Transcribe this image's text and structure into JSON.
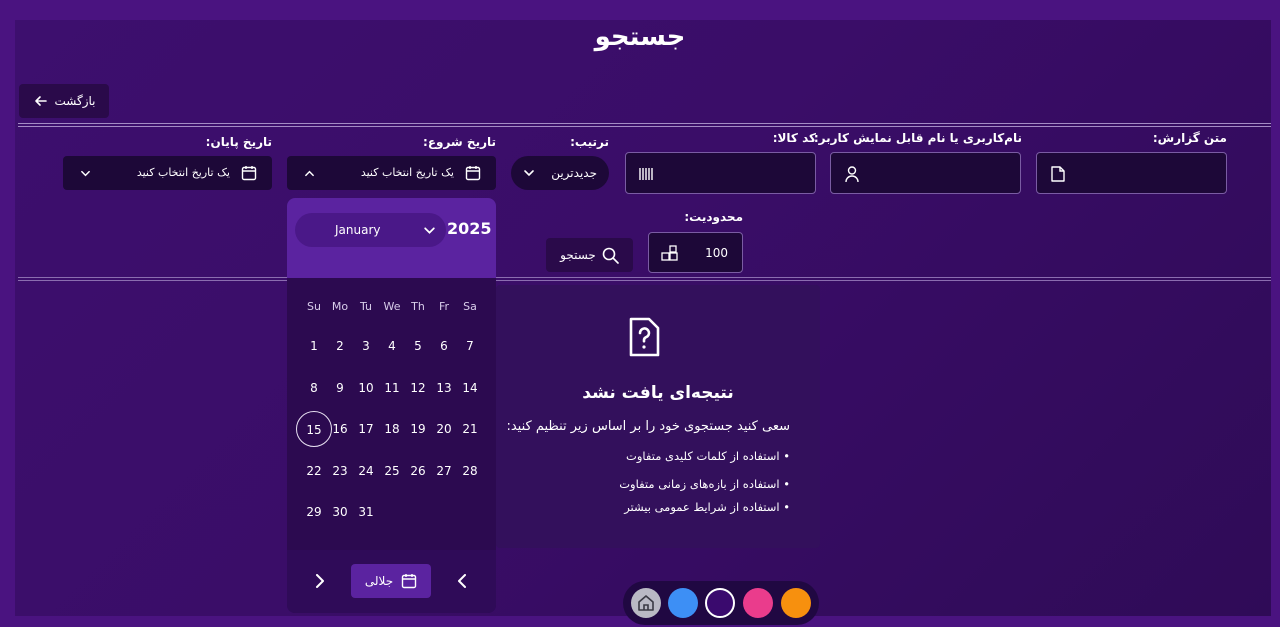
{
  "page": {
    "title": "جستجو"
  },
  "back": {
    "label": "بازگشت"
  },
  "filters": {
    "report_text_label": "متن گزارش:",
    "username_label": "نام‌کاربری یا نام قابل نمایش کاربر:",
    "product_code_label": "کد کالا:",
    "sort_label": "ترتیب:",
    "sort_value": "جدیدترین",
    "start_date_label": "تاریخ شروع:",
    "start_date_placeholder": "یک تاریخ انتخاب کنید",
    "end_date_label": "تاریخ پایان:",
    "end_date_placeholder": "یک تاریخ انتخاب کنید",
    "limit_label": "محدودیت:",
    "limit_value": "100",
    "search_label": "جستجو"
  },
  "calendar": {
    "month": "January",
    "year": "2025",
    "weekdays": [
      "Su",
      "Mo",
      "Tu",
      "We",
      "Th",
      "Fr",
      "Sa"
    ],
    "selected_day": 15,
    "days": [
      [
        1,
        2,
        3,
        4,
        5,
        6,
        7
      ],
      [
        8,
        9,
        10,
        11,
        12,
        13,
        14
      ],
      [
        15,
        16,
        17,
        18,
        19,
        20,
        21
      ],
      [
        22,
        23,
        24,
        25,
        26,
        27,
        28
      ],
      [
        29,
        30,
        31
      ]
    ],
    "jalali_label": "جلالی"
  },
  "result": {
    "title": "نتیجه‌ای یافت نشد",
    "subtitle": "سعی کنید جستجوی خود را بر اساس زیر تنظیم کنید:",
    "tips": [
      "• استفاده از کلمات کلیدی متفاوت",
      "• استفاده از بازه‌های زمانی متفاوت",
      "• استفاده از شرایط عمومی بیشتر"
    ]
  },
  "themes": {
    "colors": [
      "#b9b9c4",
      "#3d8ff5",
      "#3a0a6e",
      "#ea3c8c",
      "#f7900e"
    ]
  }
}
